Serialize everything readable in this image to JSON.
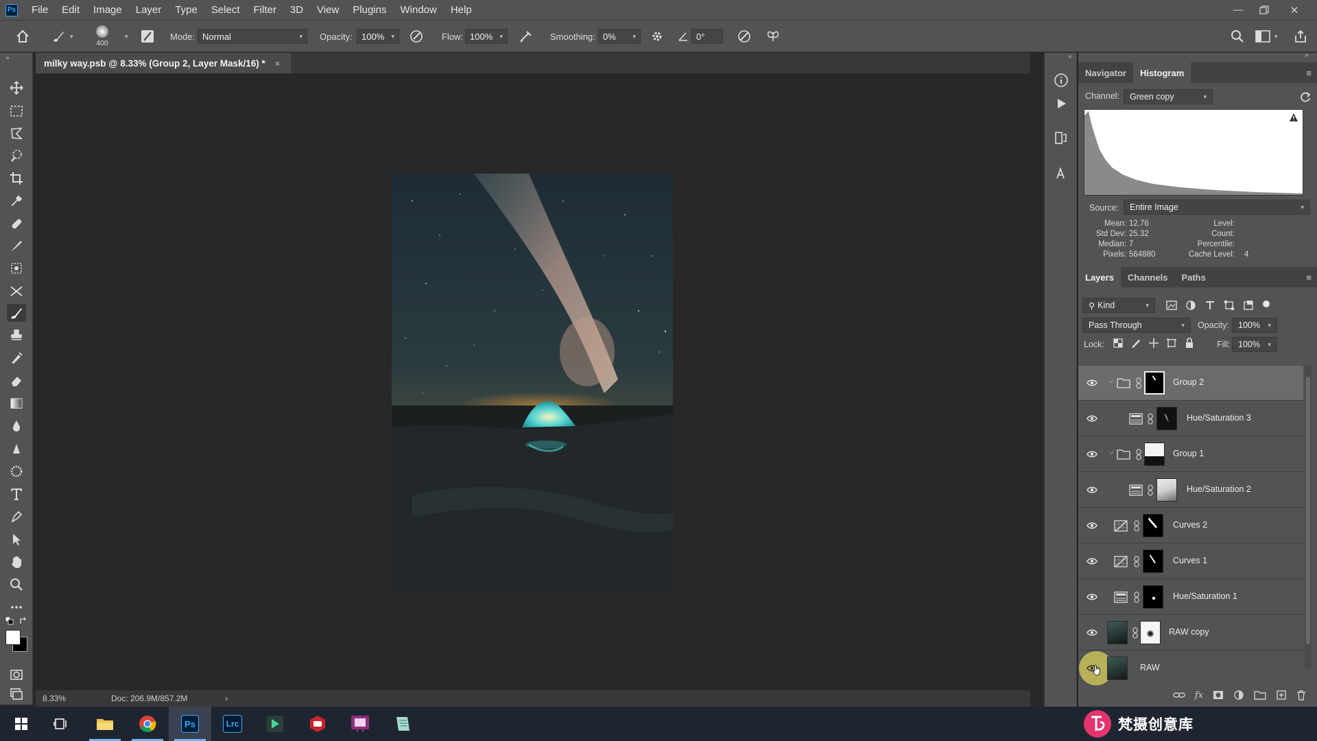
{
  "menubar": {
    "logo": "Ps",
    "items": [
      "File",
      "Edit",
      "Image",
      "Layer",
      "Type",
      "Select",
      "Filter",
      "3D",
      "View",
      "Plugins",
      "Window",
      "Help"
    ]
  },
  "options": {
    "brush_size": "400",
    "mode_label": "Mode:",
    "mode_value": "Normal",
    "opacity_label": "Opacity:",
    "opacity_value": "100%",
    "flow_label": "Flow:",
    "flow_value": "100%",
    "smoothing_label": "Smoothing:",
    "smoothing_value": "0%",
    "angle_value": "0°"
  },
  "document": {
    "tab_title": "milky way.psb @ 8.33% (Group 2, Layer Mask/16) *",
    "close_glyph": "×"
  },
  "status": {
    "zoom": "8.33%",
    "doc_size": "Doc: 206.9M/857.2M",
    "arrow": "›"
  },
  "histogram_panel": {
    "tabs": [
      "Navigator",
      "Histogram"
    ],
    "active_tab": "Histogram",
    "channel_label": "Channel:",
    "channel_value": "Green copy",
    "source_label": "Source:",
    "source_value": "Entire Image",
    "stats_left": [
      {
        "label": "Mean:",
        "value": "12.76"
      },
      {
        "label": "Std Dev:",
        "value": "25.32"
      },
      {
        "label": "Median:",
        "value": "7"
      },
      {
        "label": "Pixels:",
        "value": "564880"
      }
    ],
    "stats_right": [
      {
        "label": "Level:",
        "value": ""
      },
      {
        "label": "Count:",
        "value": ""
      },
      {
        "label": "Percentile:",
        "value": ""
      },
      {
        "label": "Cache Level:",
        "value": "4"
      }
    ]
  },
  "layers_panel": {
    "tabs": [
      "Layers",
      "Channels",
      "Paths"
    ],
    "active_tab": "Layers",
    "filter_value": "Kind",
    "blend_mode": "Pass Through",
    "opacity_label": "Opacity:",
    "opacity_value": "100%",
    "lock_label": "Lock:",
    "fill_label": "Fill:",
    "fill_value": "100%",
    "layers": [
      {
        "name": "Group 2",
        "kind": "group",
        "selected": true
      },
      {
        "name": "Hue/Saturation 3",
        "kind": "hue",
        "selected": false
      },
      {
        "name": "Group 1",
        "kind": "group",
        "selected": false
      },
      {
        "name": "Hue/Saturation 2",
        "kind": "hue",
        "selected": false
      },
      {
        "name": "Curves 2",
        "kind": "curves",
        "selected": false
      },
      {
        "name": "Curves 1",
        "kind": "curves",
        "selected": false
      },
      {
        "name": "Hue/Saturation 1",
        "kind": "hue",
        "selected": false
      },
      {
        "name": "RAW copy",
        "kind": "image-mask",
        "selected": false
      },
      {
        "name": "RAW",
        "kind": "image",
        "selected": false
      }
    ]
  },
  "taskbar": {
    "apps": [
      "start",
      "task-view",
      "file-explorer",
      "chrome",
      "Ps",
      "Lrc",
      "app-green",
      "app-red",
      "app-purple",
      "app-notes"
    ],
    "active_app": "Ps",
    "ps_label": "Ps",
    "lrc_label": "Lrc"
  },
  "watermark": {
    "text": "梵摄创意库"
  },
  "colors": {
    "chrome_bg": "#535353",
    "canvas_bg": "#282828",
    "selected_layer": "#6b6b6b",
    "ps_blue": "#31a8ff",
    "taskbar": "#1f2530"
  }
}
